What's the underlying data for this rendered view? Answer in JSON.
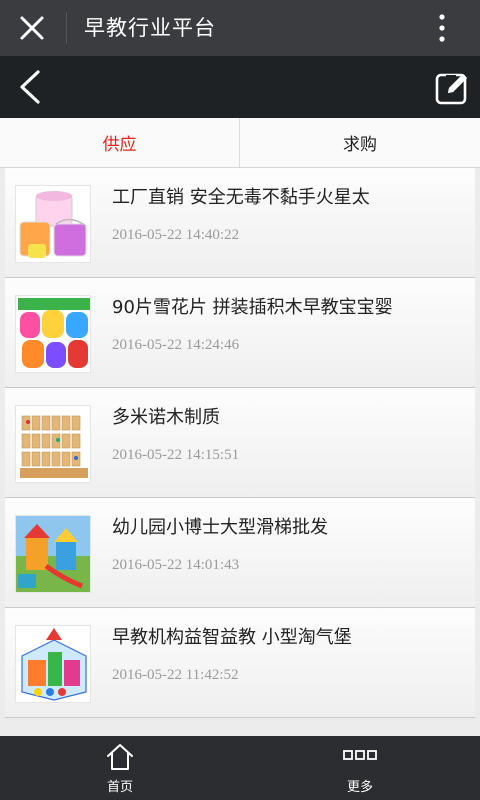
{
  "titlebar": {
    "title": "早教行业平台",
    "icons": [
      "close-icon",
      "more-vertical-icon"
    ]
  },
  "navbar": {
    "icons": [
      "back-chevron-icon",
      "edit-icon"
    ]
  },
  "tabs": [
    {
      "label": "供应",
      "active": true
    },
    {
      "label": "求购",
      "active": false
    }
  ],
  "items": [
    {
      "name": "工厂直销 安全无毒不黏手火星太",
      "date": "2016-05-22 14:40:22",
      "thumb": "slime-buckets"
    },
    {
      "name": "90片雪花片 拼装插积木早教宝宝婴",
      "date": "2016-05-22 14:24:46",
      "thumb": "snowflake-blocks"
    },
    {
      "name": "多米诺木制质",
      "date": "2016-05-22 14:15:51",
      "thumb": "wooden-dominoes"
    },
    {
      "name": "幼儿园小博士大型滑梯批发",
      "date": "2016-05-22 14:01:43",
      "thumb": "playground-slide"
    },
    {
      "name": "早教机构益智益教 小型淘气堡",
      "date": "2016-05-22 11:42:52",
      "thumb": "indoor-playground"
    }
  ],
  "bottombar": [
    {
      "label": "首页",
      "icon": "home-icon"
    },
    {
      "label": "更多",
      "icon": "more-grid-icon"
    }
  ],
  "colors": {
    "accent": "#e5211c",
    "titlebar": "#3a3c40",
    "navbar": "#1f2225",
    "bottombar": "#2b2d30"
  }
}
